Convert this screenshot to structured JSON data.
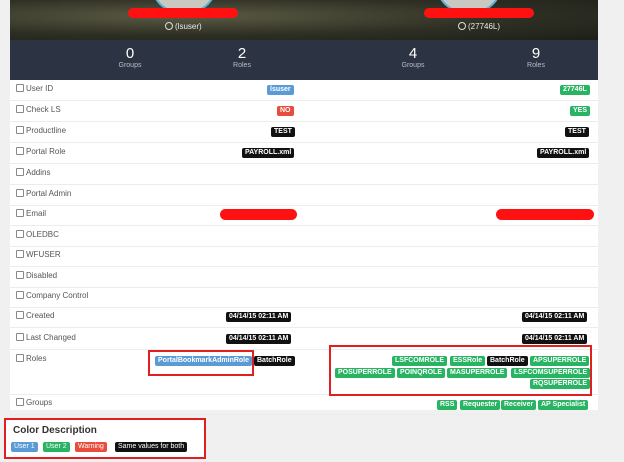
{
  "users": {
    "left": {
      "name": "(lsuser)",
      "groups": "0",
      "roles": "2"
    },
    "right": {
      "name": "(27746L)",
      "groups": "4",
      "roles": "9"
    }
  },
  "labels": {
    "groups": "Groups",
    "roles": "Roles"
  },
  "rows": [
    {
      "label": "User ID",
      "left": "lsuser",
      "right": "27746L"
    },
    {
      "label": "Check LS",
      "left": "NO",
      "right": "YES"
    },
    {
      "label": "Productline",
      "left": "TEST",
      "right": "TEST"
    },
    {
      "label": "Portal Role",
      "left": "PAYROLL.xml",
      "right": "PAYROLL.xml"
    },
    {
      "label": "Addins",
      "left": "",
      "right": ""
    },
    {
      "label": "Portal Admin",
      "left": "",
      "right": ""
    },
    {
      "label": "Email",
      "left": "",
      "right": ""
    },
    {
      "label": "OLEDBC",
      "left": "",
      "right": ""
    },
    {
      "label": "WFUSER",
      "left": "",
      "right": ""
    },
    {
      "label": "Disabled",
      "left": "",
      "right": ""
    },
    {
      "label": "Company Control",
      "left": "",
      "right": ""
    },
    {
      "label": "Created",
      "left": "04/14/15 02:11 AM",
      "right": "04/14/15 02:11 AM"
    },
    {
      "label": "Last Changed",
      "left": "04/14/15 02:11 AM",
      "right": "04/14/15 02:11 AM"
    },
    {
      "label": "Roles",
      "left": "",
      "right": ""
    },
    {
      "label": "Groups",
      "left": "",
      "right": ""
    }
  ],
  "roles_left": [
    "PortalBookmarkAdminRole",
    "BatchRole"
  ],
  "roles_right": [
    "LSFCOMROLE",
    "ESSRole",
    "BatchRole",
    "APSUPERROLE",
    "POSUPERROLE",
    "POINQROLE",
    "MASUPERROLE",
    "LSFCOMSUPERROLE",
    "RQSUPERROLE"
  ],
  "groups_right": [
    "RSS",
    "Requester",
    "Receiver",
    "AP Specialist"
  ],
  "legend": {
    "title": "Color Description",
    "items": [
      "User 1",
      "User 2",
      "Warning",
      "Same values for both"
    ]
  },
  "colors": {
    "user1": "#5b9bd5",
    "user2": "#28b463",
    "warning": "#e74c3c",
    "same": "#111111",
    "highlight": "#e02020"
  }
}
